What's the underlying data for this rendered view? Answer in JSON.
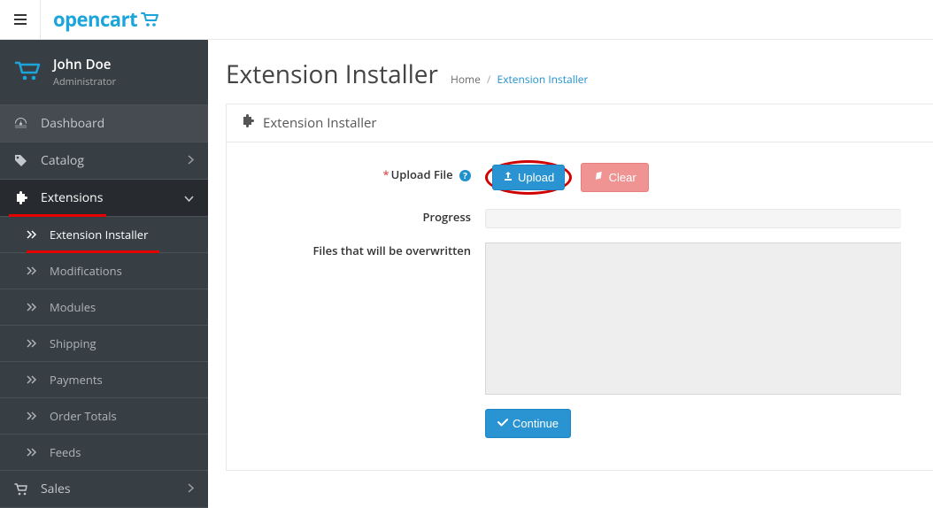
{
  "header": {
    "logo_text": "opencart"
  },
  "user": {
    "name": "John Doe",
    "role": "Administrator"
  },
  "nav": {
    "dashboard": "Dashboard",
    "catalog": "Catalog",
    "extensions": "Extensions",
    "sales": "Sales"
  },
  "subnav": {
    "extension_installer": "Extension Installer",
    "modifications": "Modifications",
    "modules": "Modules",
    "shipping": "Shipping",
    "payments": "Payments",
    "order_totals": "Order Totals",
    "feeds": "Feeds"
  },
  "page": {
    "title": "Extension Installer",
    "breadcrumb_home": "Home",
    "breadcrumb_current": "Extension Installer",
    "panel_title": "Extension Installer"
  },
  "form": {
    "upload_label": "Upload File",
    "upload_btn": "Upload",
    "clear_btn": "Clear",
    "progress_label": "Progress",
    "overwrite_label": "Files that will be overwritten",
    "continue_btn": "Continue"
  }
}
